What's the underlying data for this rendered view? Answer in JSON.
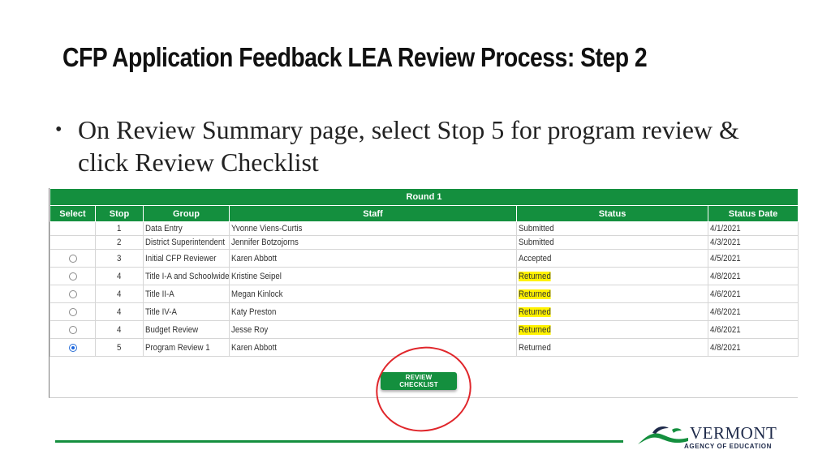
{
  "slide": {
    "title": "CFP Application Feedback LEA Review Process: Step 2",
    "bullet": "On Review Summary page, select Stop 5 for program review & click Review Checklist"
  },
  "table": {
    "round_label": "Round 1",
    "columns": [
      "Select",
      "Stop",
      "Group",
      "Staff",
      "Status",
      "Status Date"
    ],
    "rows": [
      {
        "radio": "none",
        "stop": "1",
        "group": "Data Entry",
        "staff": "Yvonne Viens-Curtis",
        "status": "Submitted",
        "highlight": false,
        "date": "4/1/2021"
      },
      {
        "radio": "none",
        "stop": "2",
        "group": "District Superintendent",
        "staff": "Jennifer Botzojorns",
        "status": "Submitted",
        "highlight": false,
        "date": "4/3/2021"
      },
      {
        "radio": "unchecked",
        "stop": "3",
        "group": "Initial CFP Reviewer",
        "staff": "Karen Abbott",
        "status": "Accepted",
        "highlight": false,
        "date": "4/5/2021"
      },
      {
        "radio": "unchecked",
        "stop": "4",
        "group": "Title I-A and Schoolwide",
        "staff": "Kristine Seipel",
        "status": "Returned",
        "highlight": true,
        "date": "4/8/2021"
      },
      {
        "radio": "unchecked",
        "stop": "4",
        "group": "Title II-A",
        "staff": "Megan Kinlock",
        "status": "Returned",
        "highlight": true,
        "date": "4/6/2021"
      },
      {
        "radio": "unchecked",
        "stop": "4",
        "group": "Title IV-A",
        "staff": "Katy Preston",
        "status": "Returned",
        "highlight": true,
        "date": "4/6/2021"
      },
      {
        "radio": "unchecked",
        "stop": "4",
        "group": "Budget Review",
        "staff": "Jesse Roy",
        "status": "Returned",
        "highlight": true,
        "date": "4/6/2021"
      },
      {
        "radio": "checked",
        "stop": "5",
        "group": "Program Review 1",
        "staff": "Karen Abbott",
        "status": "Returned",
        "highlight": false,
        "date": "4/8/2021"
      }
    ],
    "button_label": "REVIEW CHECKLIST"
  },
  "logo": {
    "name": "VERMONT",
    "subtitle": "AGENCY OF EDUCATION",
    "icon": "mountain-leaf-icon"
  },
  "colors": {
    "brand_green": "#148f3e",
    "highlight": "#fff200",
    "annotation_red": "#e0262b",
    "logo_navy": "#1e2a4a"
  }
}
